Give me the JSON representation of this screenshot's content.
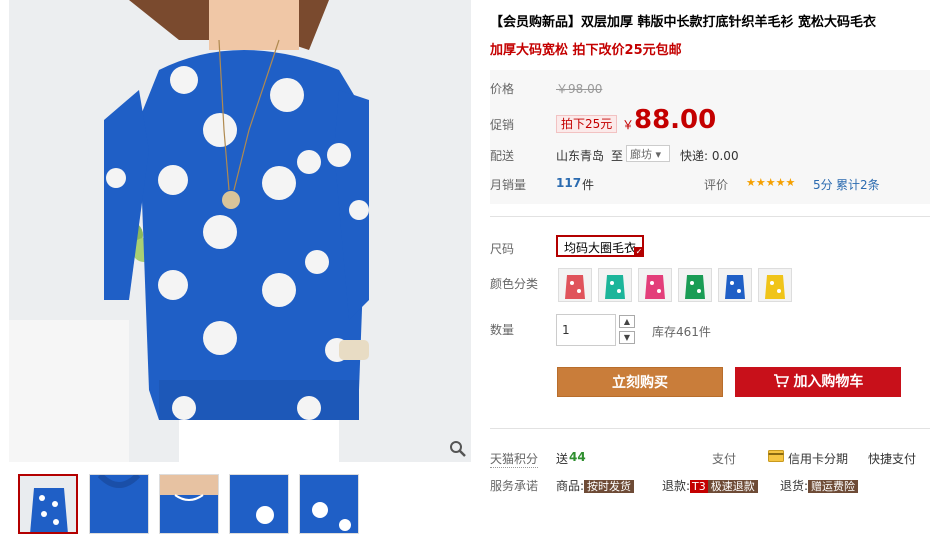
{
  "product": {
    "title": "【会员购新品】双层加厚 韩版中长款打底针织羊毛衫 宽松大码毛衣",
    "subtitle": "加厚大码宽松 拍下改价25元包邮"
  },
  "price": {
    "label": "价格",
    "original": "￥98.00",
    "promo_label": "促销",
    "promo_tag": "拍下25元",
    "currency": "￥",
    "current": "88.00"
  },
  "shipping": {
    "label": "配送",
    "from": "山东青岛",
    "to_label": "至",
    "destination": "廊坊 ▾",
    "fee": "快递: 0.00"
  },
  "sales": {
    "label": "月销量",
    "count": "117",
    "unit": "件",
    "rating_label": "评价",
    "stars": "★★★★★",
    "score": "5分",
    "total": "累计2条"
  },
  "options": {
    "size_label": "尺码",
    "size_value": "均码大圈毛衣",
    "color_label": "颜色分类",
    "colors": [
      "red-dots",
      "teal-dots",
      "pink-dots",
      "green-dots",
      "blue-dots",
      "yellow-dots"
    ],
    "qty_label": "数量",
    "qty_value": "1",
    "stock": "库存461件"
  },
  "actions": {
    "buy_now": "立刻购买",
    "add_cart": "加入购物车"
  },
  "bottom": {
    "points_label": "天猫积分",
    "points_prefix": "送",
    "points_value": "44",
    "pay_label": "支付",
    "credit": "信用卡分期",
    "quick_pay": "快捷支付",
    "service_label": "服务承诺",
    "goods_label": "商品:",
    "goods_tag": "按时发货",
    "refund_label": "退款:",
    "refund_badge": "T3",
    "refund_tag": "极速退款",
    "return_label": "退货:",
    "return_tag": "赠运费险"
  },
  "colors": {
    "accent_red": "#c40000",
    "buy_now_bg": "#c97d3a",
    "cart_bg": "#c8101a",
    "sweater_blue": "#1f5fc6"
  },
  "icons": [
    "zoom-icon",
    "cart-icon",
    "credit-card-icon",
    "check-icon"
  ]
}
